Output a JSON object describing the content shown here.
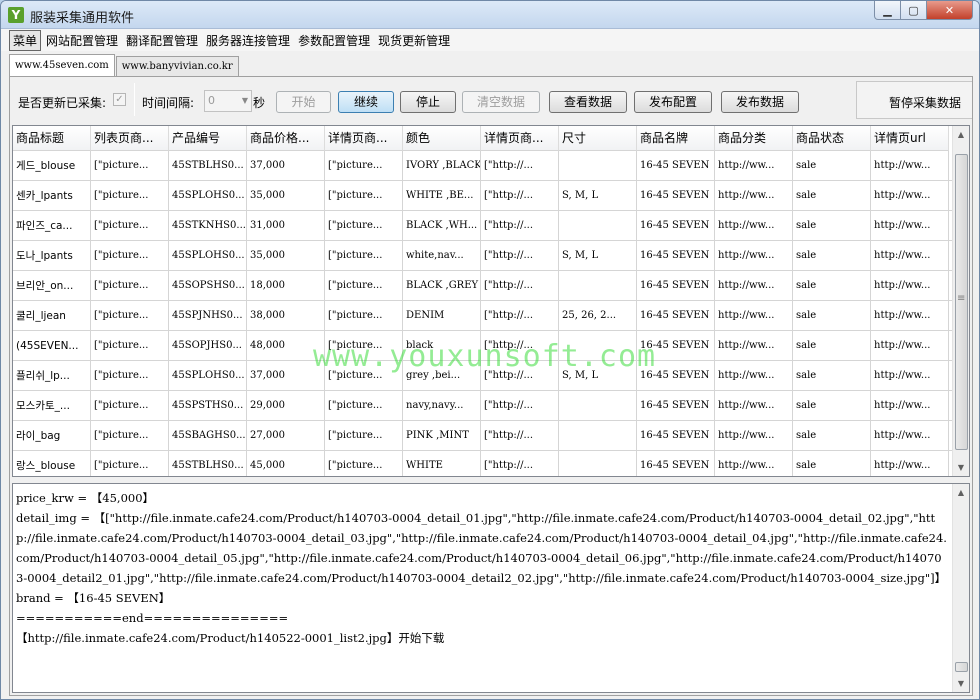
{
  "window": {
    "title": "服装采集通用软件",
    "app_icon": "Y",
    "buttons": {
      "minimize": "▁",
      "maximize": "▢",
      "close": "✕"
    }
  },
  "menu": [
    "菜单",
    "网站配置管理",
    "翻译配置管理",
    "服务器连接管理",
    "参数配置管理",
    "现货更新管理"
  ],
  "tabs": [
    "www.45seven.com",
    "www.banyvivian.co.kr"
  ],
  "toolbar": {
    "update_label": "是否更新已采集:",
    "interval_label": "时间间隔:",
    "interval_value": "0",
    "seconds_label": "秒",
    "start": "开始",
    "continue": "继续",
    "stop": "停止",
    "clear": "清空数据",
    "view": "查看数据",
    "publish_config": "发布配置",
    "publish_data": "发布数据",
    "pause": "暂停采集数据"
  },
  "grid": {
    "columns": [
      "商品标题",
      "列表页商...",
      "产品编号",
      "商品价格...",
      "详情页商...",
      "颜色",
      "详情页商...",
      "尺寸",
      "商品名牌",
      "商品分类",
      "商品状态",
      "详情页url"
    ],
    "rows": [
      [
        "게드_blouse",
        "[\"picture...",
        "45STBLHS0...",
        "37,000",
        "[\"picture...",
        "IVORY ,BLACK",
        "[\"http://...",
        "",
        "16-45 SEVEN",
        "http://ww...",
        "sale",
        "http://ww..."
      ],
      [
        "센카_lpants",
        "[\"picture...",
        "45SPLOHS0...",
        "35,000",
        "[\"picture...",
        "WHITE ,BE...",
        "[\"http://...",
        "S, M, L",
        "16-45 SEVEN",
        "http://ww...",
        "sale",
        "http://ww..."
      ],
      [
        "파인즈_ca...",
        "[\"picture...",
        "45STKNHS0...",
        "31,000",
        "[\"picture...",
        "BLACK ,WH...",
        "[\"http://...",
        "",
        "16-45 SEVEN",
        "http://ww...",
        "sale",
        "http://ww..."
      ],
      [
        "도나_lpants",
        "[\"picture...",
        "45SPLOHS0...",
        "35,000",
        "[\"picture...",
        "white,nav...",
        "[\"http://...",
        "S, M, L",
        "16-45 SEVEN",
        "http://ww...",
        "sale",
        "http://ww..."
      ],
      [
        "브리안_on...",
        "[\"picture...",
        "45SOPSHS0...",
        "18,000",
        "[\"picture...",
        "BLACK ,GREY",
        "[\"http://...",
        "",
        "16-45 SEVEN",
        "http://ww...",
        "sale",
        "http://ww..."
      ],
      [
        "쿨리_ljean",
        "[\"picture...",
        "45SPJNHS0...",
        "38,000",
        "[\"picture...",
        "DENIM",
        "[\"http://...",
        "25, 26, 2...",
        "16-45 SEVEN",
        "http://ww...",
        "sale",
        "http://ww..."
      ],
      [
        "(45SEVEN...",
        "[\"picture...",
        "45SOPJHS0...",
        "48,000",
        "[\"picture...",
        "black",
        "[\"http://...",
        "",
        "16-45 SEVEN",
        "http://ww...",
        "sale",
        "http://ww..."
      ],
      [
        "플리쉬_lp...",
        "[\"picture...",
        "45SPLOHS0...",
        "37,000",
        "[\"picture...",
        "grey ,bei...",
        "[\"http://...",
        "S, M, L",
        "16-45 SEVEN",
        "http://ww...",
        "sale",
        "http://ww..."
      ],
      [
        "모스카토_...",
        "[\"picture...",
        "45SPSTHS0...",
        "29,000",
        "[\"picture...",
        "navy,navy...",
        "[\"http://...",
        "",
        "16-45 SEVEN",
        "http://ww...",
        "sale",
        "http://ww..."
      ],
      [
        "라이_bag",
        "[\"picture...",
        "45SBAGHS0...",
        "27,000",
        "[\"picture...",
        "PINK ,MINT",
        "[\"http://...",
        "",
        "16-45 SEVEN",
        "http://ww...",
        "sale",
        "http://ww..."
      ],
      [
        "랑스_blouse",
        "[\"picture...",
        "45STBLHS0...",
        "45,000",
        "[\"picture...",
        "WHITE",
        "[\"http://...",
        "",
        "16-45 SEVEN",
        "http://ww...",
        "sale",
        "http://ww..."
      ]
    ]
  },
  "log": {
    "lines": [
      "price_krw = 【45,000】",
      "detail_img = 【[\"http://file.inmate.cafe24.com/Product/h140703-0004_detail_01.jpg\",\"http://file.inmate.cafe24.com/Product/h140703-0004_detail_02.jpg\",\"http://file.inmate.cafe24.com/Product/h140703-0004_detail_03.jpg\",\"http://file.inmate.cafe24.com/Product/h140703-0004_detail_04.jpg\",\"http://file.inmate.cafe24.com/Product/h140703-0004_detail_05.jpg\",\"http://file.inmate.cafe24.com/Product/h140703-0004_detail_06.jpg\",\"http://file.inmate.cafe24.com/Product/h140703-0004_detail2_01.jpg\",\"http://file.inmate.cafe24.com/Product/h140703-0004_detail2_02.jpg\",\"http://file.inmate.cafe24.com/Product/h140703-0004_size.jpg\"]】",
      "brand = 【16-45 SEVEN】",
      "===========end===============",
      "【http://file.inmate.cafe24.com/Product/h140522-0001_list2.jpg】开始下载"
    ]
  },
  "watermark": "www.youxunsoft.com"
}
